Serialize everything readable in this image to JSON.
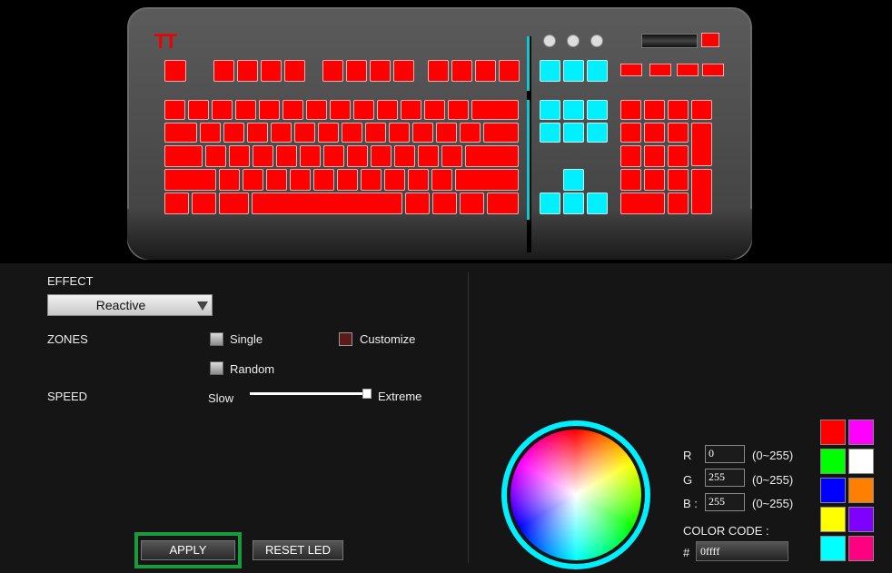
{
  "effect": {
    "label": "EFFECT",
    "selected": "Reactive"
  },
  "zones": {
    "label": "ZONES",
    "single": "Single",
    "customize": "Customize",
    "random": "Random"
  },
  "speed": {
    "label": "SPEED",
    "min_label": "Slow",
    "max_label": "Extreme",
    "value": 1.0
  },
  "buttons": {
    "apply": "APPLY",
    "reset": "RESET LED"
  },
  "rgb": {
    "r_label": "R",
    "r_value": "0",
    "r_range": "(0~255)",
    "g_label": "G",
    "g_value": "255",
    "g_range": "(0~255)",
    "b_label": "B :",
    "b_value": "255",
    "b_range": "(0~255)",
    "code_label": "COLOR CODE :",
    "hash": "#",
    "code_value": "0ffff"
  },
  "swatches": [
    "#ff0000",
    "#ff00ff",
    "#00ff00",
    "#ffffff",
    "#0000ff",
    "#ff8000",
    "#ffff00",
    "#8000ff",
    "#00ffff",
    "#ff0080"
  ],
  "colors": {
    "key_red": "#ff0000",
    "key_cyan": "#00f0ff",
    "apply_highlight": "#1a9a3a",
    "wheel_ring": "#00f0ff"
  }
}
